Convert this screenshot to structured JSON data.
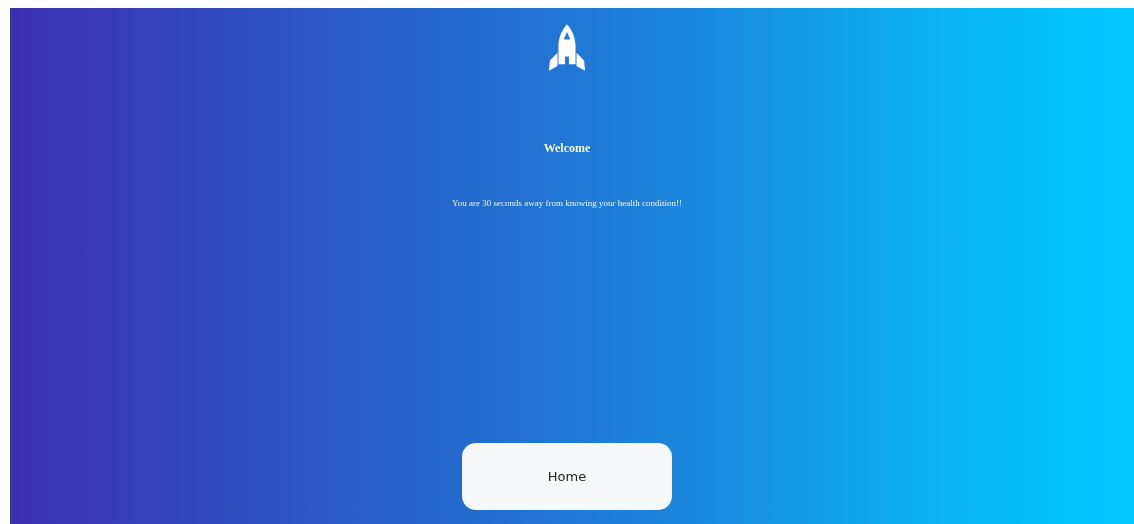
{
  "heading": "Welcome",
  "message": "You are 30 seconds away from knowing your health condition!!",
  "button": {
    "label": "Home"
  }
}
